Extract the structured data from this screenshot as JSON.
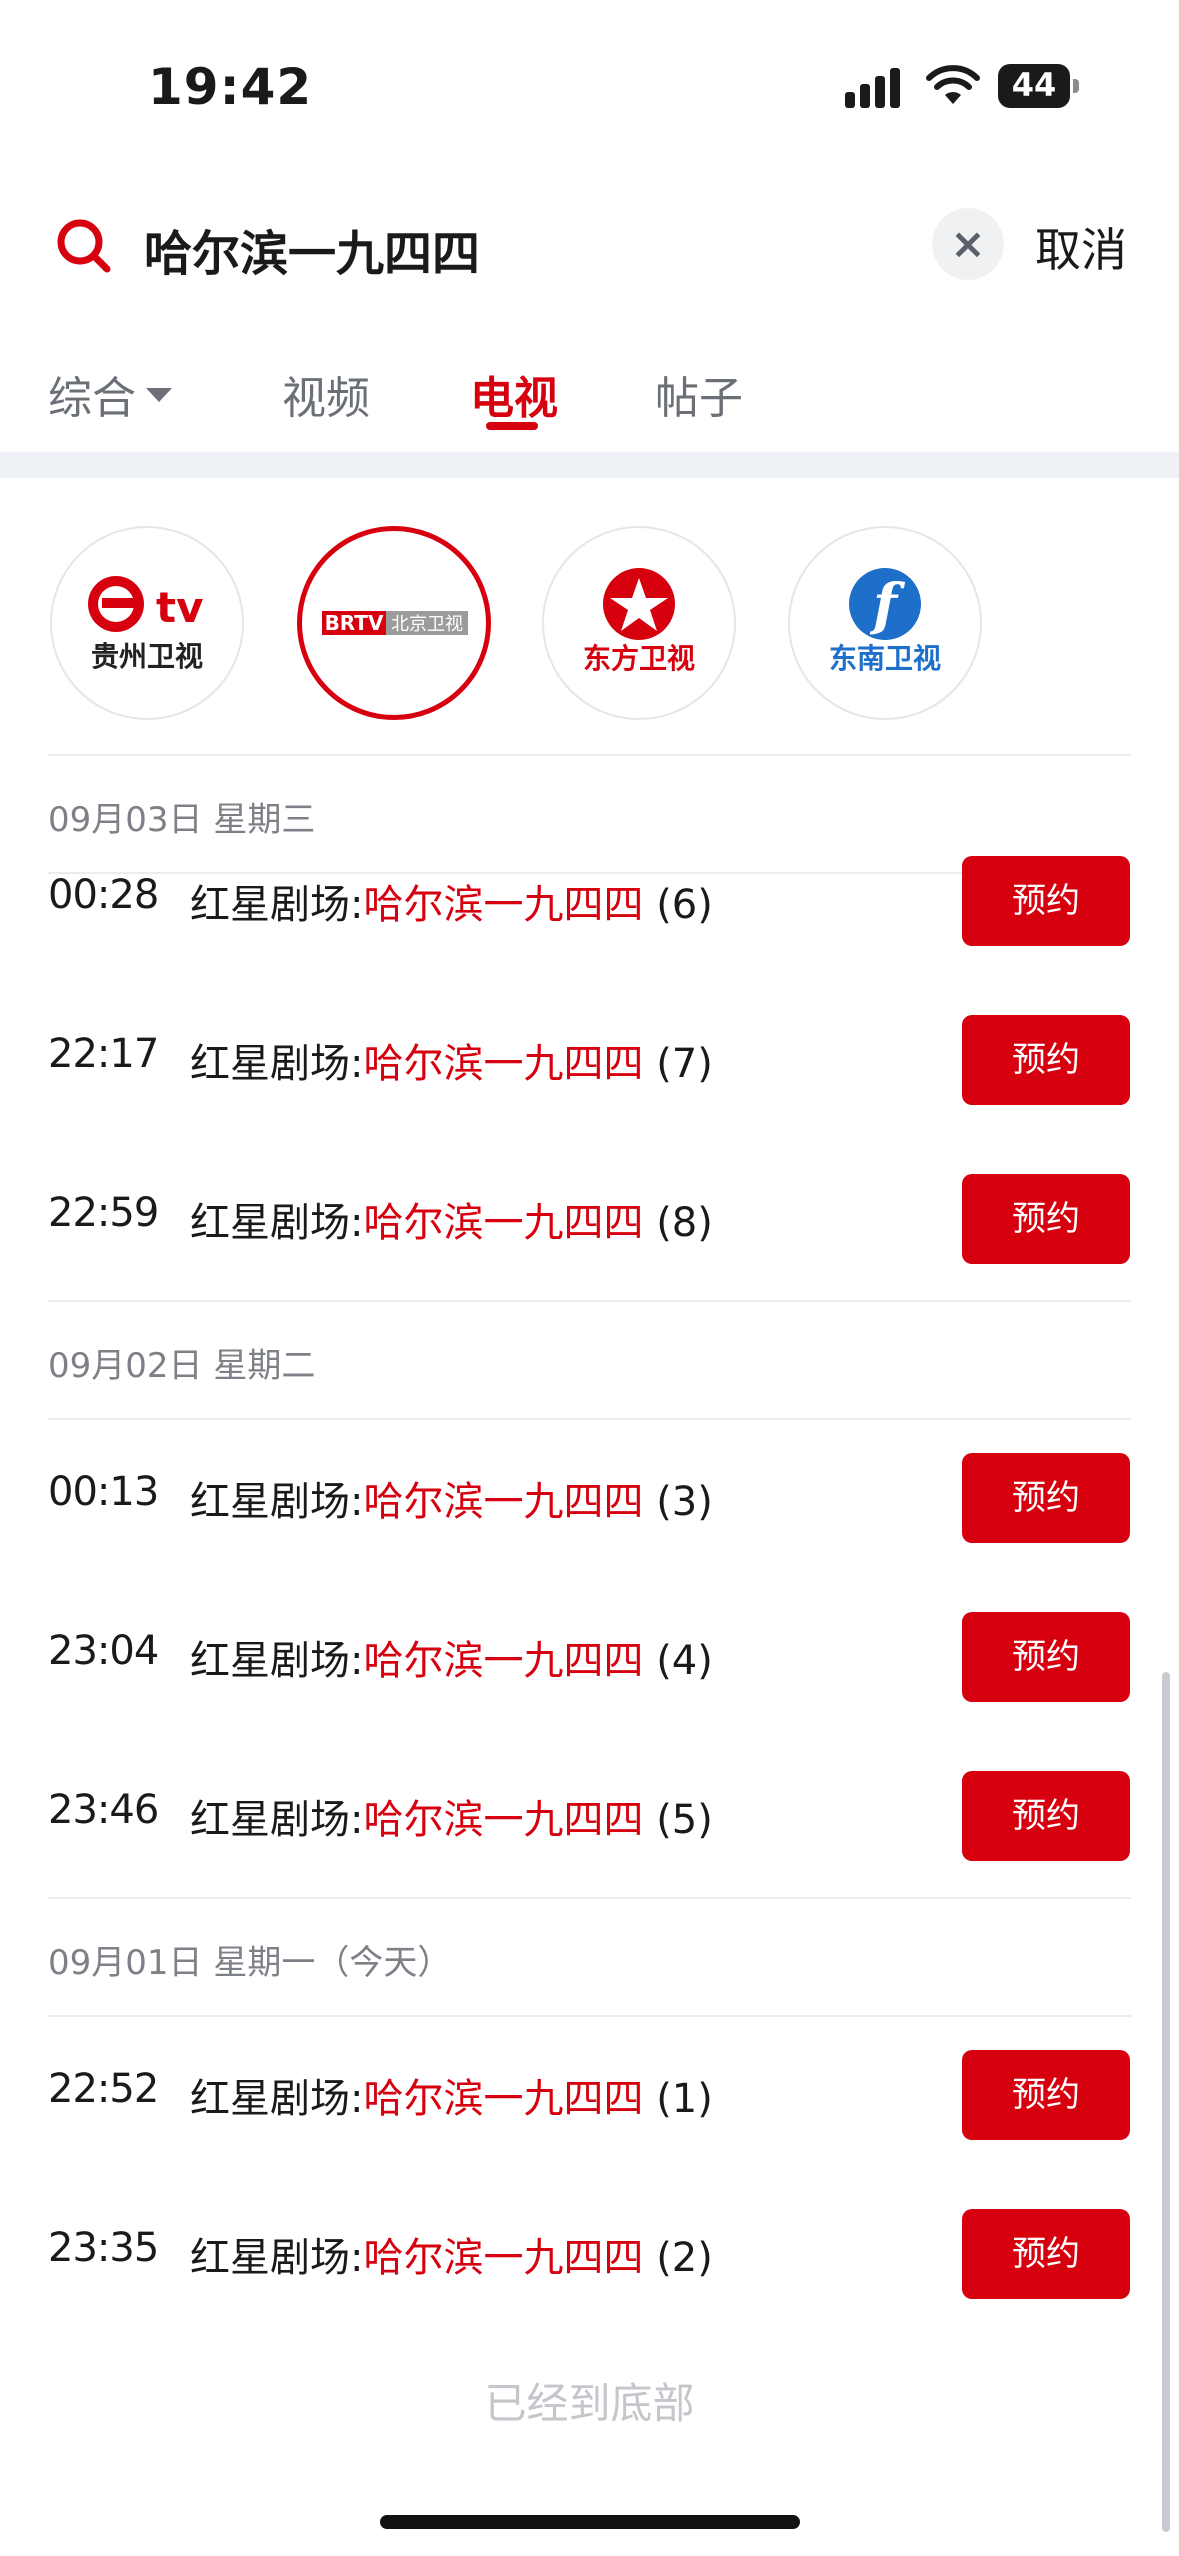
{
  "status_bar": {
    "time": "19:42",
    "battery": "44"
  },
  "search": {
    "query": "哈尔滨一九四四",
    "cancel_label": "取消",
    "clear_label": "×"
  },
  "tabs": [
    {
      "label": "综合",
      "has_dropdown": true,
      "active": false
    },
    {
      "label": "视频",
      "active": false
    },
    {
      "label": "电视",
      "active": true
    },
    {
      "label": "帖子",
      "active": false
    }
  ],
  "channels": [
    {
      "name": "贵州卫视",
      "logo_text": "tv",
      "selected": false,
      "icon": "guizhou-tv-logo"
    },
    {
      "name": "BRTV北京卫视",
      "logo_text": "BRTV",
      "logo_text2": "北京卫视",
      "selected": true,
      "icon": "beijing-tv-logo"
    },
    {
      "name": "东方卫视",
      "selected": false,
      "icon": "dragon-tv-logo"
    },
    {
      "name": "东南卫视",
      "logo_text": "f",
      "selected": false,
      "icon": "southeast-tv-logo"
    }
  ],
  "schedule": [
    {
      "date": "09月03日  星期三",
      "items": [
        {
          "time": "00:28",
          "prefix": "红星剧场:",
          "program": "哈尔滨一九四四",
          "episode": "(6)",
          "action": "预约"
        },
        {
          "time": "22:17",
          "prefix": "红星剧场:",
          "program": "哈尔滨一九四四",
          "episode": "(7)",
          "action": "预约"
        },
        {
          "time": "22:59",
          "prefix": "红星剧场:",
          "program": "哈尔滨一九四四",
          "episode": "(8)",
          "action": "预约"
        }
      ]
    },
    {
      "date": "09月02日  星期二",
      "items": [
        {
          "time": "00:13",
          "prefix": "红星剧场:",
          "program": "哈尔滨一九四四",
          "episode": "(3)",
          "action": "预约"
        },
        {
          "time": "23:04",
          "prefix": "红星剧场:",
          "program": "哈尔滨一九四四",
          "episode": "(4)",
          "action": "预约"
        },
        {
          "time": "23:46",
          "prefix": "红星剧场:",
          "program": "哈尔滨一九四四",
          "episode": "(5)",
          "action": "预约"
        }
      ]
    },
    {
      "date": "09月01日  星期一（今天）",
      "items": [
        {
          "time": "22:52",
          "prefix": "红星剧场:",
          "program": "哈尔滨一九四四",
          "episode": "(1)",
          "action": "预约"
        },
        {
          "time": "23:35",
          "prefix": "红星剧场:",
          "program": "哈尔滨一九四四",
          "episode": "(2)",
          "action": "预约"
        }
      ]
    }
  ],
  "footer": {
    "end_text": "已经到底部"
  },
  "colors": {
    "accent": "#d7000f",
    "muted": "#7d8087",
    "band": "#eef1f5"
  }
}
